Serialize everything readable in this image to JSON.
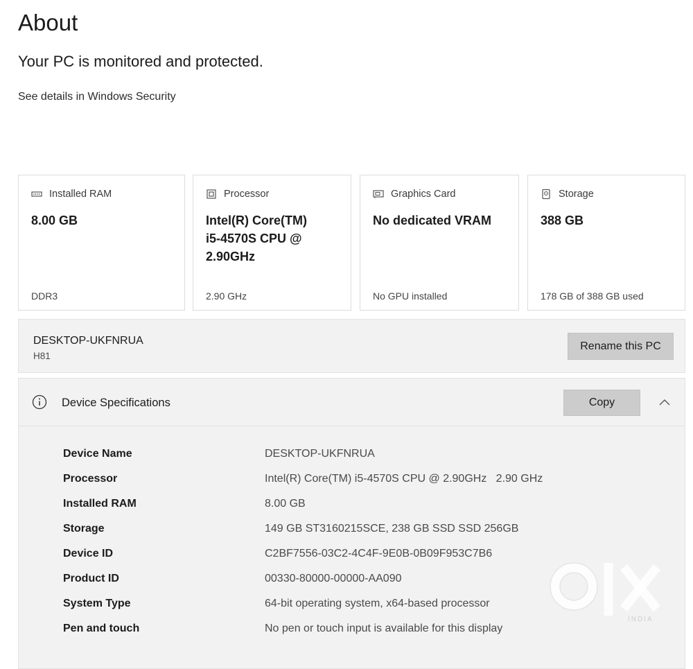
{
  "header": {
    "title": "About",
    "status": "Your PC is monitored and protected.",
    "security_link": "See details in Windows Security"
  },
  "cards": [
    {
      "icon": "ram-icon",
      "label": "Installed RAM",
      "value": "8.00 GB",
      "sub": "DDR3"
    },
    {
      "icon": "processor-icon",
      "label": "Processor",
      "value": "Intel(R) Core(TM) i5-4570S CPU @ 2.90GHz",
      "sub": "2.90 GHz"
    },
    {
      "icon": "graphics-card-icon",
      "label": "Graphics Card",
      "value": "No dedicated VRAM",
      "sub": "No GPU installed"
    },
    {
      "icon": "storage-icon",
      "label": "Storage",
      "value": "388 GB",
      "sub": "178 GB of 388 GB used"
    }
  ],
  "pc": {
    "name": "DESKTOP-UKFNRUA",
    "model": "H81",
    "rename_label": "Rename this PC"
  },
  "specs": {
    "title": "Device Specifications",
    "copy_label": "Copy",
    "rows": [
      {
        "label": "Device Name",
        "value": "DESKTOP-UKFNRUA"
      },
      {
        "label": "Processor",
        "value": "Intel(R) Core(TM) i5-4570S CPU @ 2.90GHz   2.90 GHz"
      },
      {
        "label": "Installed RAM",
        "value": "8.00 GB"
      },
      {
        "label": "Storage",
        "value": "149 GB ST3160215SCE, 238 GB SSD SSD 256GB"
      },
      {
        "label": "Device ID",
        "value": "C2BF7556-03C2-4C4F-9E0B-0B09F953C7B6"
      },
      {
        "label": "Product ID",
        "value": "00330-80000-00000-AA090"
      },
      {
        "label": "System Type",
        "value": "64-bit operating system, x64-based processor"
      },
      {
        "label": "Pen and touch",
        "value": "No pen or touch input is available for this display"
      }
    ]
  },
  "watermark": {
    "brand": "OLX",
    "region": "INDIA"
  }
}
